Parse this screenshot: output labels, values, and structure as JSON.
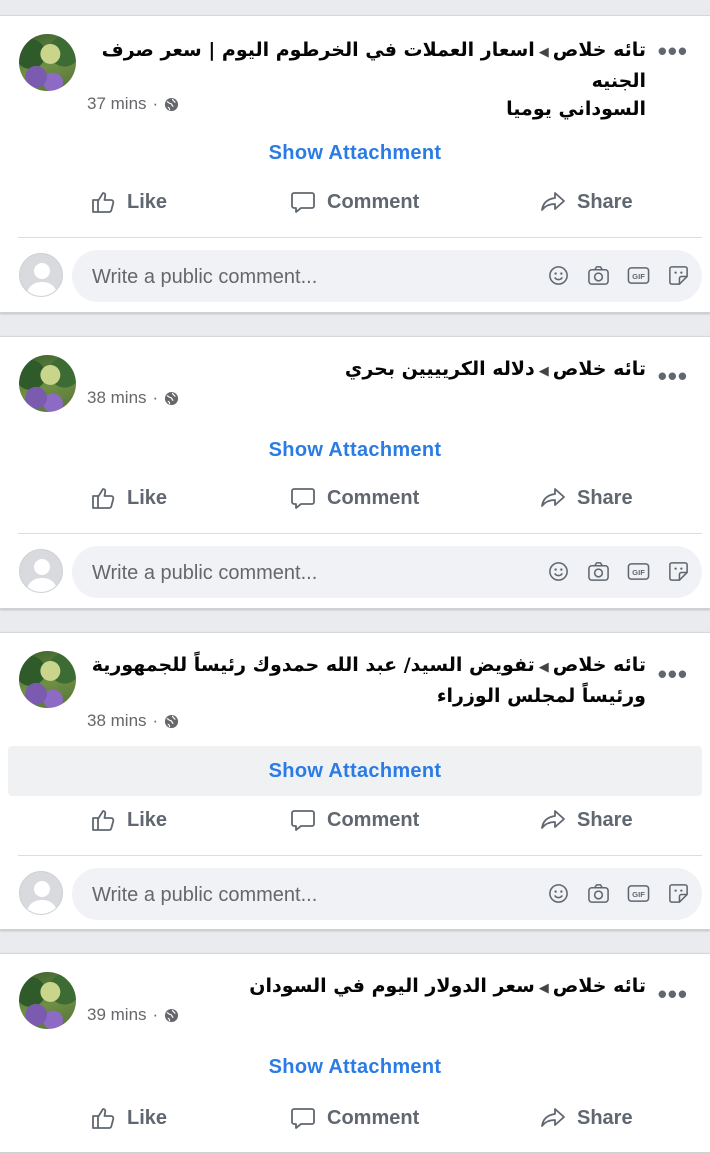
{
  "posts": [
    {
      "title": "تائه خلاص",
      "text_line1": "اسعار العملات في الخرطوم اليوم | سعر صرف الجنيه",
      "text_line2": "السوداني يوميا",
      "time": "37 mins",
      "attachment_label": "Show Attachment",
      "comment_placeholder": "Write a public comment..."
    },
    {
      "title": "تائه خلاص",
      "text_line1": "دلاله الكريييين بحري",
      "text_line2": "",
      "time": "38 mins",
      "attachment_label": "Show Attachment",
      "comment_placeholder": "Write a public comment..."
    },
    {
      "title": "تائه خلاص",
      "text_line1": "تفويض السيد/ عبد الله حمدوك رئيساً للجمهورية",
      "text_line2": "ورئيساً لمجلس الوزراء",
      "time": "38 mins",
      "attachment_label": "Show Attachment",
      "comment_placeholder": "Write a public comment..."
    },
    {
      "title": "تائه خلاص",
      "text_line1": "سعر الدولار اليوم في السودان",
      "text_line2": "",
      "time": "39 mins",
      "attachment_label": "Show Attachment",
      "comment_placeholder": "Write a public comment..."
    }
  ],
  "actions": {
    "like": "Like",
    "comment": "Comment",
    "share": "Share"
  },
  "icons": {
    "more": "more-dots-icon",
    "privacy": "globe-icon",
    "like": "thumbs-up-icon",
    "comment": "speech-bubble-icon",
    "share": "share-arrow-icon",
    "emoji": "emoji-icon",
    "camera": "camera-icon",
    "gif": "gif-icon",
    "sticker": "sticker-icon"
  },
  "colors": {
    "link": "#2a7be4",
    "muted": "#606770",
    "background": "#e9ebee"
  }
}
